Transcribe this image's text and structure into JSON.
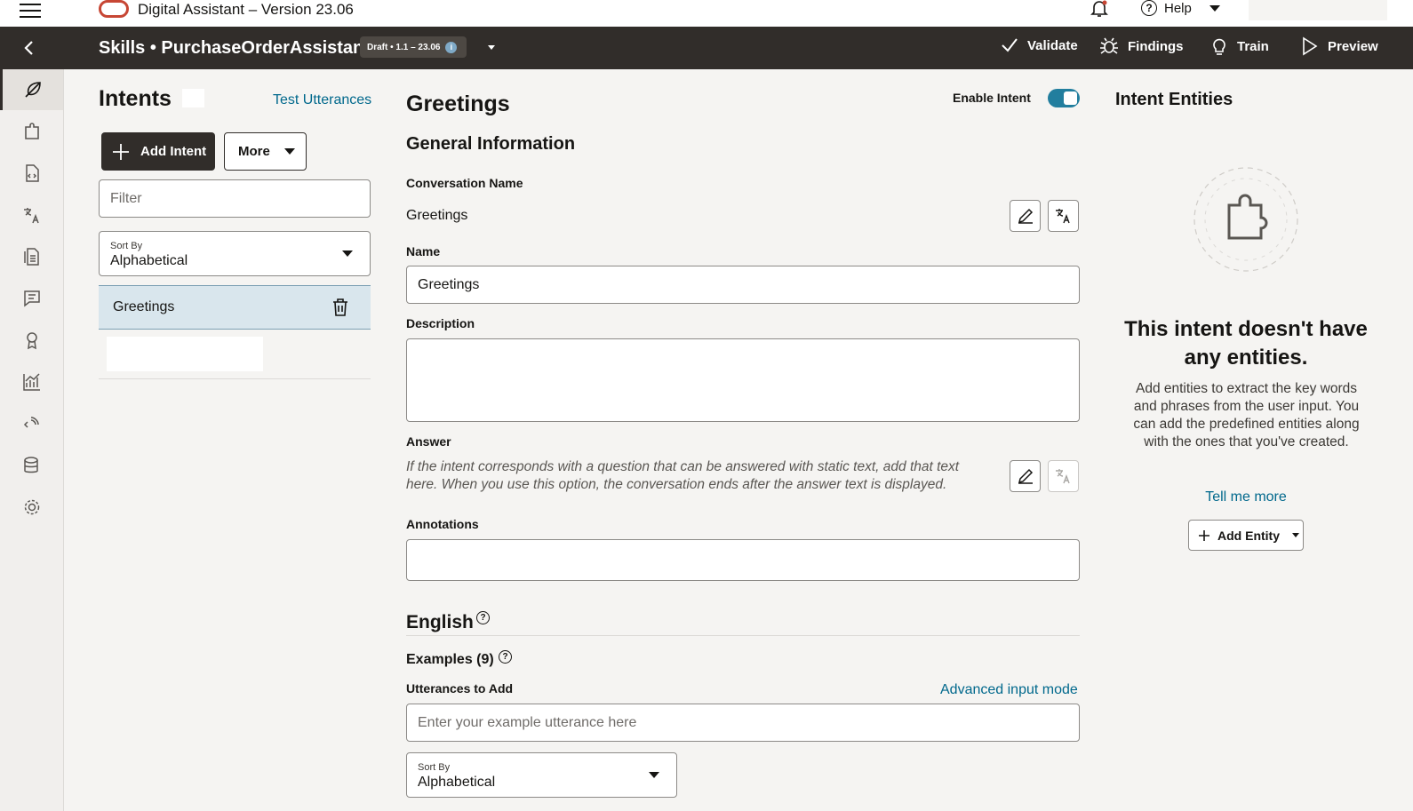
{
  "topbar": {
    "app_title": "Digital Assistant – Version 23.06",
    "help_label": "Help"
  },
  "header": {
    "breadcrumb": "Skills • PurchaseOrderAssistant",
    "version_badge": "Draft • 1.1 – 23.06",
    "actions": {
      "validate": "Validate",
      "findings": "Findings",
      "train": "Train",
      "preview": "Preview"
    }
  },
  "intents_panel": {
    "title": "Intents",
    "test_link": "Test Utterances",
    "add_button": "Add Intent",
    "more_button": "More",
    "filter_placeholder": "Filter",
    "sort_label": "Sort By",
    "sort_value": "Alphabetical",
    "items": [
      {
        "label": "Greetings",
        "selected": true
      }
    ]
  },
  "detail": {
    "title": "Greetings",
    "enable_label": "Enable Intent",
    "enabled": true,
    "general_heading": "General Information",
    "conversation_name_label": "Conversation Name",
    "conversation_name_value": "Greetings",
    "name_label": "Name",
    "name_value": "Greetings",
    "description_label": "Description",
    "description_value": "",
    "answer_label": "Answer",
    "answer_hint": "If the intent corresponds with a question that can be answered with static text, add that text here. When you use this option, the conversation ends after the answer text is displayed.",
    "annotations_label": "Annotations",
    "language_heading": "English",
    "examples_heading": "Examples (9)",
    "utterances_label": "Utterances to Add",
    "advanced_link": "Advanced input mode",
    "utterance_placeholder": "Enter your example utterance here",
    "sort_label": "Sort By",
    "sort_value": "Alphabetical"
  },
  "entities_panel": {
    "title": "Intent Entities",
    "empty_heading": "This intent doesn't have any entities.",
    "empty_body": "Add entities to extract the key words and phrases from the user input. You can add the predefined entities along with the ones that you've created.",
    "tell_more_link": "Tell me more",
    "add_entity_button": "Add Entity"
  },
  "nav_rail": {
    "icons": [
      "intents-icon",
      "entities-icon",
      "flows-icon",
      "translation-icon",
      "resource-bundles-icon",
      "conversations-icon",
      "insights-achievement-icon",
      "analytics-icon",
      "components-icon",
      "data-icon",
      "settings-icon"
    ]
  },
  "colors": {
    "header_bg": "#312d2a",
    "link": "#00688c",
    "toggle_on": "#227e9e",
    "selected_row": "#d9e6ed",
    "brand_red": "#c74634"
  }
}
